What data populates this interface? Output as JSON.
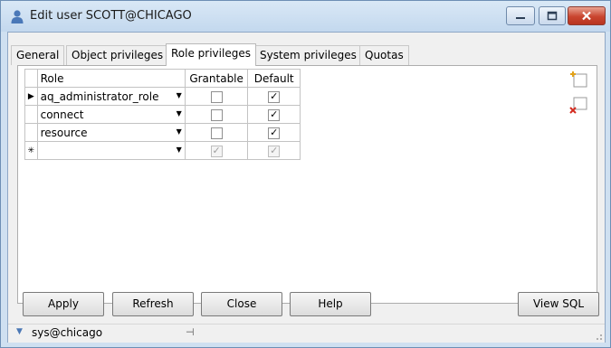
{
  "window": {
    "title": "Edit user SCOTT@CHICAGO",
    "minimize_glyph": "—",
    "maximize_glyph": "□",
    "close_glyph": "✕"
  },
  "tabs": [
    {
      "label": "General"
    },
    {
      "label": "Object privileges"
    },
    {
      "label": "Role privileges",
      "active": true
    },
    {
      "label": "System privileges"
    },
    {
      "label": "Quotas"
    }
  ],
  "grid": {
    "columns": {
      "role": "Role",
      "grantable": "Grantable",
      "default": "Default"
    },
    "rows": [
      {
        "indicator": "▶",
        "role": "aq_administrator_role",
        "grantable": false,
        "default": true
      },
      {
        "indicator": "",
        "role": "connect",
        "grantable": false,
        "default": true
      },
      {
        "indicator": "",
        "role": "resource",
        "grantable": false,
        "default": true
      }
    ],
    "new_row": {
      "indicator": "✳",
      "role": "",
      "grantable": true,
      "default": true
    }
  },
  "icons": {
    "add": "add-row-icon",
    "delete": "delete-row-icon"
  },
  "buttons": {
    "apply": "Apply",
    "refresh": "Refresh",
    "close": "Close",
    "help": "Help",
    "view_sql": "View SQL"
  },
  "status": {
    "connection": "sys@chicago",
    "pin_glyph": "⊣"
  }
}
